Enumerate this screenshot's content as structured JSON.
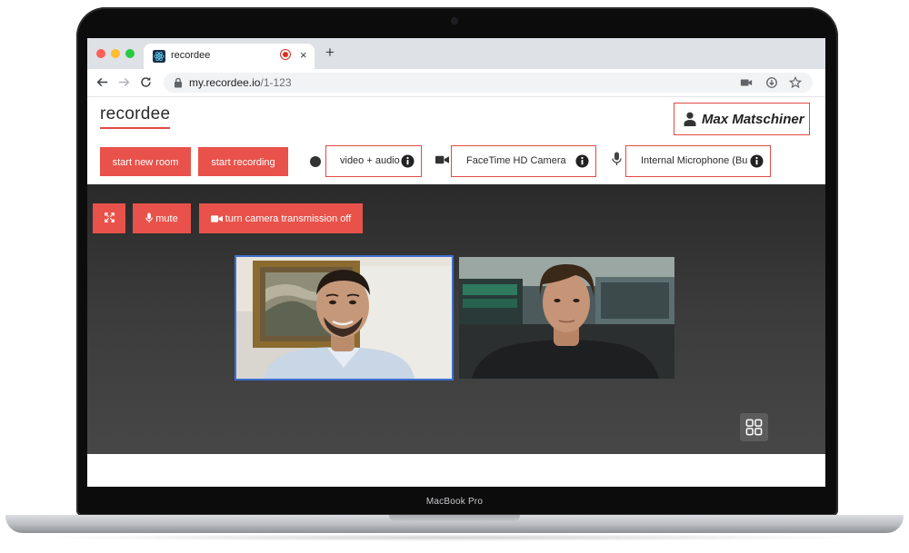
{
  "device": {
    "model_label": "MacBook Pro"
  },
  "browser": {
    "tab_title": "recordee",
    "url_host": "my.recordee.io",
    "url_path": "/1-123",
    "new_tab_symbol": "+",
    "close_tab_symbol": "×",
    "recording_indicator": true
  },
  "app": {
    "logo": "recordee",
    "user_name": "Max Matschiner",
    "buttons": {
      "start_new_room": "start new room",
      "start_recording": "start recording"
    },
    "selects": {
      "mode": "video + audio",
      "camera": "FaceTime HD Camera",
      "microphone": "Internal Microphone (Bu"
    }
  },
  "call_controls": {
    "mute": "mute",
    "camera_toggle": "turn camera transmission off"
  },
  "participants": [
    {
      "id": "participant-1",
      "active_speaker": true
    },
    {
      "id": "participant-2",
      "active_speaker": false
    }
  ],
  "icons": {
    "favicon": "react-atom-icon",
    "lock": "lock-icon",
    "fullscreen": "fullscreen-icon",
    "microphone": "microphone-icon",
    "camera": "video-camera-icon",
    "screen_share": "monitor-icon",
    "chat": "chat-icon",
    "grid": "grid-view-icon",
    "more": "more-vertical-icon"
  },
  "colors": {
    "accent": "#e8524a",
    "accent_border": "#e04b45",
    "active_speaker_border": "#3d6fd1",
    "call_background": "#3b3b3b"
  }
}
